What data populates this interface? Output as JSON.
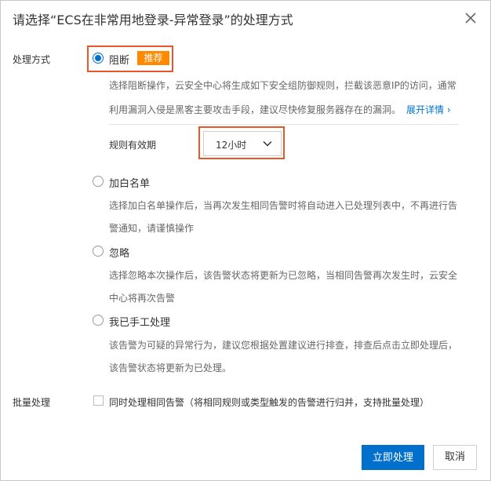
{
  "dialog": {
    "title": "请选择“ECS在非常用地登录-异常登录”的处理方式"
  },
  "method": {
    "label": "处理方式",
    "options": [
      {
        "label": "阻断",
        "selected": true,
        "badge": "推荐",
        "desc": [
          "选择阻断操作，云安全中心将生成如下安全组防御规则，拦截该恶意IP的访问，通常",
          "利用漏洞入侵是黑客主要攻击手段，建议尽快修复服务器存在的漏洞。"
        ],
        "link": "展开详情 ›",
        "rule_label": "规则有效期",
        "rule_value": "12小时"
      },
      {
        "label": "加白名单",
        "selected": false,
        "desc": [
          "选择加白名单操作后，当再次发生相同告警时将自动进入已处理列表中，不再进行告",
          "警通知，请谨慎操作"
        ]
      },
      {
        "label": "忽略",
        "selected": false,
        "desc": [
          "选择忽略本次操作后，该告警状态将更新为已忽略，当相同告警再次发生时，云安全",
          "中心将再次告警"
        ]
      },
      {
        "label": "我已手工处理",
        "selected": false,
        "desc": [
          "该告警为可疑的异常行为，建议您根据处置建议进行排查，排查后点击立即处理后，",
          "该告警状态将更新为已处理。"
        ]
      }
    ]
  },
  "batch": {
    "label": "批量处理",
    "checkbox_label": "同时处理相同告警（将相同规则或类型触发的告警进行归并，支持批量处理）",
    "checked": false
  },
  "buttons": {
    "confirm": "立即处理",
    "cancel": "取消"
  },
  "colors": {
    "primary": "#0070cc",
    "badge": "#ff8a00",
    "highlight": "#e8562a"
  }
}
